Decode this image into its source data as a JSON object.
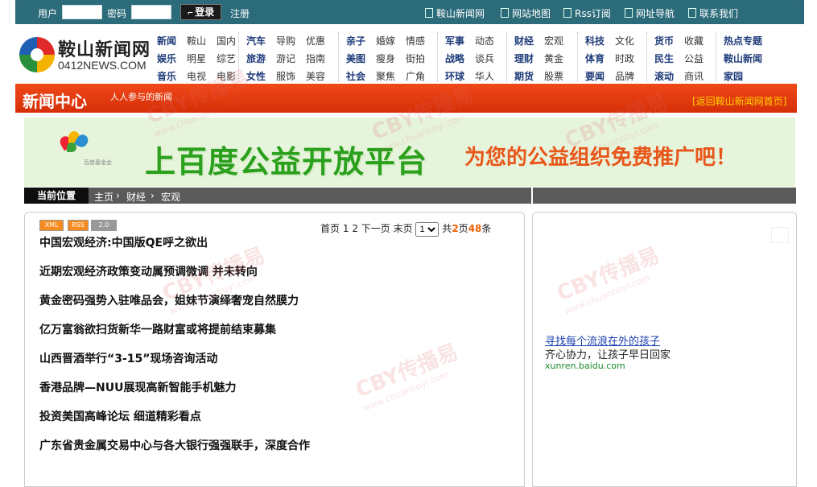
{
  "topbar": {
    "user_label": "用户",
    "password_label": "密码",
    "login_label": "登录",
    "register_label": "注册",
    "links": [
      "鞍山新闻网",
      "网站地图",
      "Rss订阅",
      "网址导航",
      "联系我们"
    ]
  },
  "logo": {
    "cn": "鞍山新闻网",
    "en": "0412NEWS.COM"
  },
  "nav": {
    "groups": [
      [
        [
          "新闻",
          "鞍山",
          "国内"
        ],
        [
          "娱乐",
          "明星",
          "综艺"
        ],
        [
          "音乐",
          "电视",
          "电影"
        ]
      ],
      [
        [
          "汽车",
          "导购",
          "优惠"
        ],
        [
          "旅游",
          "游记",
          "指南"
        ],
        [
          "女性",
          "服饰",
          "美容"
        ]
      ],
      [
        [
          "亲子",
          "婚嫁",
          "情感"
        ],
        [
          "美图",
          "瘦身",
          "街拍"
        ],
        [
          "社会",
          "聚焦",
          "广角"
        ]
      ],
      [
        [
          "军事",
          "动态"
        ],
        [
          "战略",
          "谈兵"
        ],
        [
          "环球",
          "华人"
        ]
      ],
      [
        [
          "财经",
          "宏观"
        ],
        [
          "理财",
          "黄金"
        ],
        [
          "期货",
          "股票"
        ]
      ],
      [
        [
          "科技",
          "文化"
        ],
        [
          "体育",
          "时政"
        ],
        [
          "要闻",
          "品牌"
        ]
      ],
      [
        [
          "货币",
          "收藏"
        ],
        [
          "民生",
          "公益"
        ],
        [
          "滚动",
          "商讯"
        ]
      ],
      [
        [
          "热点专题"
        ],
        [
          "鞍山新闻"
        ],
        [
          "家园"
        ]
      ]
    ]
  },
  "section": {
    "title": "新闻中心",
    "slogan": "人人参与的新闻",
    "back_link": "[返回鞍山新闻网首页]"
  },
  "banner": {
    "logo_text": "百度基金会",
    "main": "上百度公益开放平台",
    "sub": "为您的公益组织免费推广吧！"
  },
  "breadcrumb": {
    "current_label": "当前位置",
    "items": [
      "主页",
      "财经",
      "宏观"
    ]
  },
  "badges": [
    "XML",
    "RSS",
    "2.0"
  ],
  "pager": {
    "first": "首页",
    "pages": [
      "1",
      "2"
    ],
    "next": "下一页",
    "last": "末页",
    "select_value": "1",
    "total_prefix": "共",
    "total_pages": "2",
    "pages_unit": "页",
    "total_items": "48",
    "items_unit": "条"
  },
  "articles": [
    "中国宏观经济:中国版QE呼之欲出",
    "近期宏观经济政策变动属预调微调 并未转向",
    "黄金密码强势入驻唯品会，姐妹节演绎奢宠自然膜力",
    "亿万富翁欲扫货新华一路财富或将提前结束募集",
    "山西晋酒举行“3-15”现场咨询活动",
    "香港品牌—NUU展现高新智能手机魅力",
    "投资美国高峰论坛 细道精彩看点",
    "广东省贵金属交易中心与各大银行强强联手，深度合作"
  ],
  "ad": {
    "link": "寻找每个流浪在外的孩子",
    "desc": "齐心协力，让孩子早日回家",
    "url": "xunren.baidu.com"
  },
  "watermark": {
    "main": "CBY传播易",
    "sub": "www.chuanboyi.com"
  },
  "colors": {
    "topbar": "#2c6b7a",
    "red_bar": "#e23e10",
    "banner_bg": "#e7f4dc",
    "banner_green": "#2aa01c",
    "banner_orange": "#e8561a"
  }
}
